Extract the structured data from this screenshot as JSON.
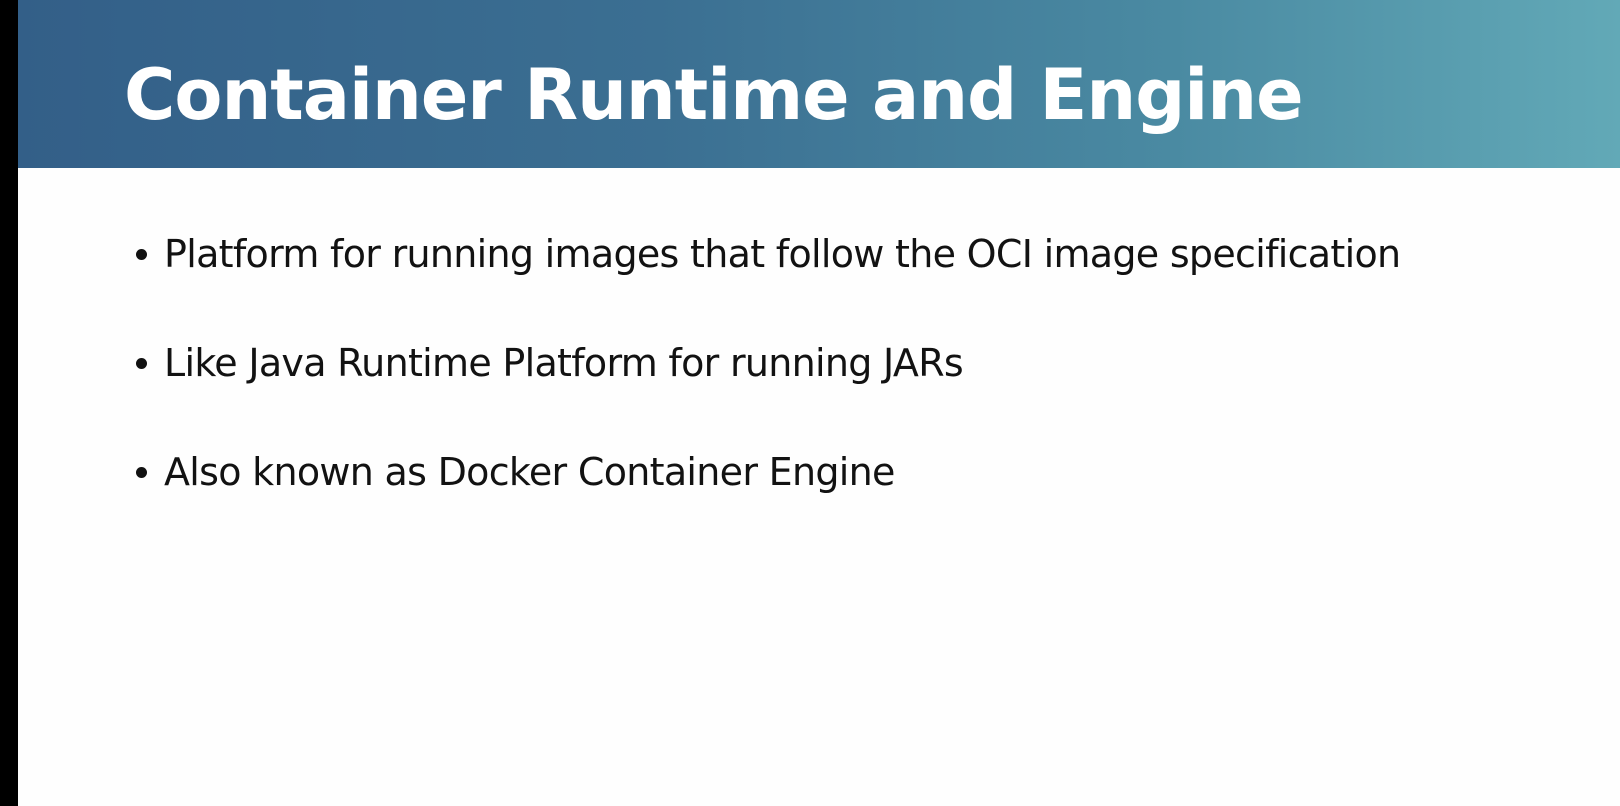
{
  "slide": {
    "title": "Container Runtime and Engine",
    "bullets": [
      {
        "text": "Platform for running images that follow the OCI image specification"
      },
      {
        "text": "Like Java Runtime Platform for running JARs"
      },
      {
        "text": "Also known as Docker Container Engine"
      }
    ]
  },
  "colors": {
    "banner_gradient_start": "#335f88",
    "banner_gradient_end": "#62a9b7",
    "title_text": "#ffffff",
    "body_text": "#121212",
    "slide_background": "#fefefe",
    "left_edge": "#000000"
  }
}
